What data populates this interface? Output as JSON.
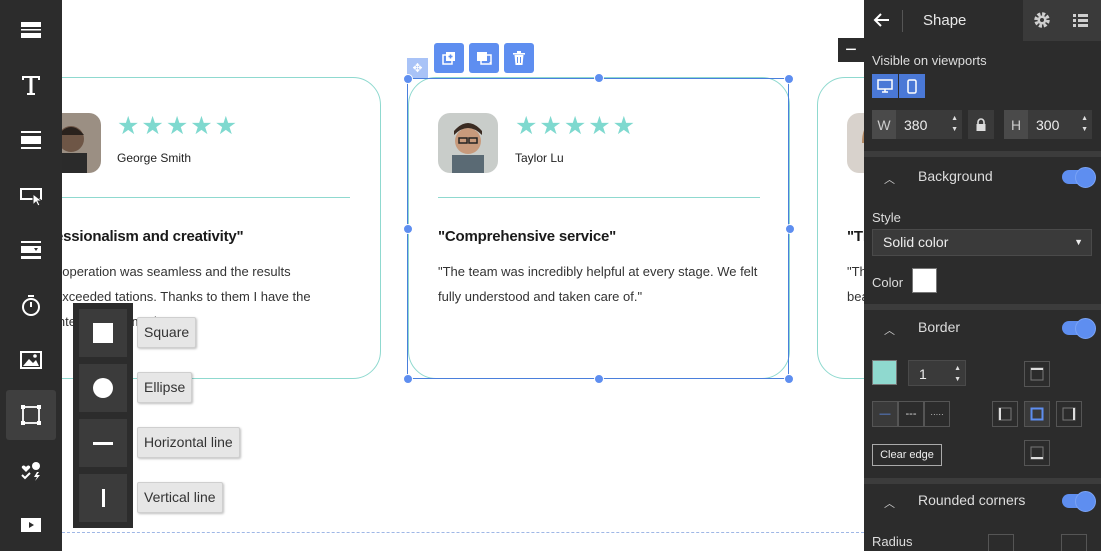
{
  "canvas": {
    "cards": [
      {
        "name": "George Smith",
        "quote_title": "essionalism and creativity\"",
        "quote_text": "ooperation was seamless and the results exceeded tations. Thanks to them I have the interior I dreamed"
      },
      {
        "name": "Taylor Lu",
        "quote_title": "\"Comprehensive service\"",
        "quote_text": "\"The team was incredibly helpful at every stage. We felt fully understood and taken care of.\""
      },
      {
        "name": "",
        "quote_title": "\"Tl",
        "quote_text": "\"Th bea"
      }
    ],
    "stars": "★★★★★",
    "rating": 5
  },
  "left_toolbar": {
    "tools": [
      "strip-layout-tool",
      "text-tool",
      "section-tool",
      "button-tool",
      "form-tool",
      "timer-tool",
      "image-tool",
      "shape-tool",
      "icons-tool",
      "video-tool"
    ],
    "active_tool": "shape-tool"
  },
  "shape_menu": {
    "square": "Square",
    "ellipse": "Ellipse",
    "horizontal_line": "Horizontal line",
    "vertical_line": "Vertical line"
  },
  "selection": {
    "move_glyph": "✥"
  },
  "collapse_tab": {
    "glyph": "−"
  },
  "right_panel": {
    "title": "Shape",
    "visible_on_viewports": "Visible on viewports",
    "width_label": "W",
    "width_value": "380",
    "height_label": "H",
    "height_value": "300",
    "background": {
      "title": "Background",
      "style_label": "Style",
      "style_value": "Solid color",
      "color_label": "Color",
      "color": "#ffffff",
      "enabled": true
    },
    "border": {
      "title": "Border",
      "color": "#8fd9cf",
      "width_value": "1",
      "line_styles": [
        "—",
        "---",
        "·····"
      ],
      "clear_edge": "Clear edge",
      "enabled": true
    },
    "rounded_corners": {
      "title": "Rounded corners",
      "radius_label": "Radius",
      "enabled": true
    }
  },
  "colors": {
    "accent_blue": "#5e8ef0",
    "teal": "#8fd9cf",
    "panel_bg": "#2c2c2c"
  }
}
